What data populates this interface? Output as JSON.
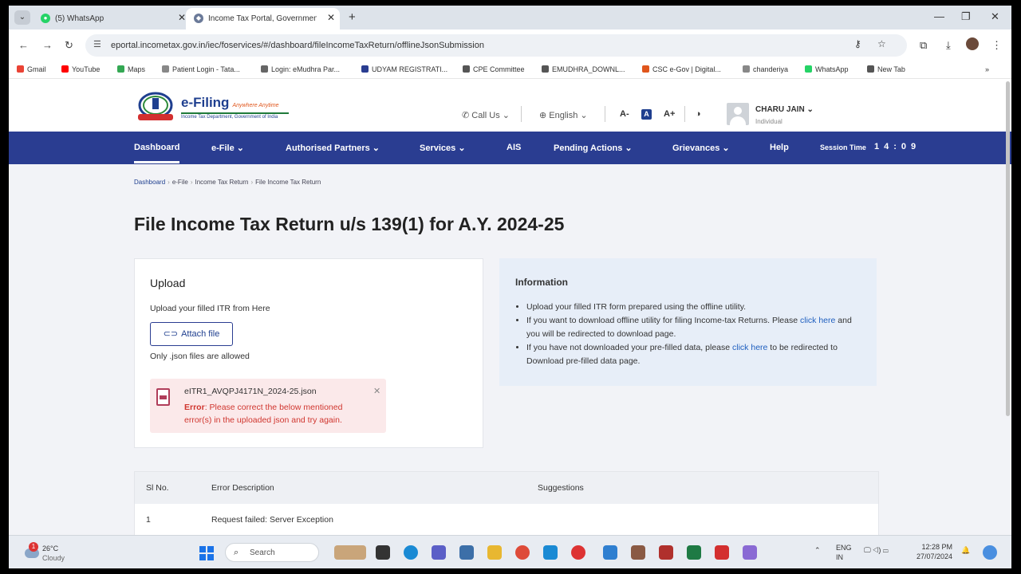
{
  "browser": {
    "tabs": [
      {
        "title": "(5) WhatsApp",
        "favicon": "whatsapp-icon"
      },
      {
        "title": "Income Tax Portal, Governmen",
        "favicon": "income-tax-icon"
      }
    ],
    "url": "eportal.incometax.gov.in/iec/foservices/#/dashboard/fileIncomeTaxReturn/offlineJsonSubmission",
    "bookmarks": [
      {
        "label": "Gmail",
        "color": "#ea4335"
      },
      {
        "label": "YouTube",
        "color": "#ff0000"
      },
      {
        "label": "Maps",
        "color": "#34a853"
      },
      {
        "label": "Patient Login - Tata...",
        "color": "#888888"
      },
      {
        "label": "Login: eMudhra Par...",
        "color": "#666666"
      },
      {
        "label": "UDYAM REGISTRATI...",
        "color": "#2a3d91"
      },
      {
        "label": "CPE Committee",
        "color": "#555555"
      },
      {
        "label": "EMUDHRA_DOWNL...",
        "color": "#555555"
      },
      {
        "label": "CSC e-Gov | Digital...",
        "color": "#e0561c"
      },
      {
        "label": "chanderiya",
        "color": "#888888"
      },
      {
        "label": "WhatsApp",
        "color": "#25d366"
      },
      {
        "label": "New Tab",
        "color": "#555555"
      }
    ]
  },
  "header": {
    "brand": "e-Filing",
    "tagline": "Anywhere Anytime",
    "dept": "Income Tax Department, Government of India",
    "call_us": "Call Us",
    "language": "English",
    "font_small": "A-",
    "font_normal": "A",
    "font_large": "A+",
    "user_name": "CHARU JAIN",
    "user_role": "Individual"
  },
  "nav": {
    "items": [
      "Dashboard",
      "e-File",
      "Authorised Partners",
      "Services",
      "AIS",
      "Pending Actions",
      "Grievances",
      "Help"
    ],
    "session_label": "Session Time",
    "session_time": "14:09"
  },
  "breadcrumb": [
    "Dashboard",
    "e-File",
    "Income Tax Return",
    "File Income Tax Return"
  ],
  "page_title": "File Income Tax Return u/s 139(1) for A.Y. 2024-25",
  "upload": {
    "heading": "Upload",
    "sub": "Upload your filled ITR from Here",
    "attach_label": "Attach file",
    "note": "Only .json files are allowed",
    "file_name": "eITR1_AVQPJ4171N_2024-25.json",
    "error_label": "Error",
    "error_text": ": Please correct the below mentioned error(s) in the uploaded json and try again."
  },
  "info": {
    "heading": "Information",
    "b1": "Upload your filled ITR form prepared using the offline utility.",
    "b2_pre": "If you want to download offline utility for filing Income-tax Returns. Please",
    "b2_link": "click here",
    "b2_post": "and you will be redirected to download page.",
    "b3_pre": "If you have not downloaded your pre-filled data, please",
    "b3_link": "click here",
    "b3_post": "to be redirected to Download pre-filled data page."
  },
  "errors_table": {
    "headers": [
      "Sl No.",
      "Error Description",
      "Suggestions"
    ],
    "rows": [
      {
        "sl": "1",
        "description": "Request failed: Server Exception",
        "suggestion": ""
      }
    ]
  },
  "taskbar": {
    "weather_badge": "1",
    "temp": "26°C",
    "condition": "Cloudy",
    "search": "Search",
    "lang1": "ENG",
    "lang2": "IN",
    "time": "12:28 PM",
    "date": "27/07/2024"
  }
}
